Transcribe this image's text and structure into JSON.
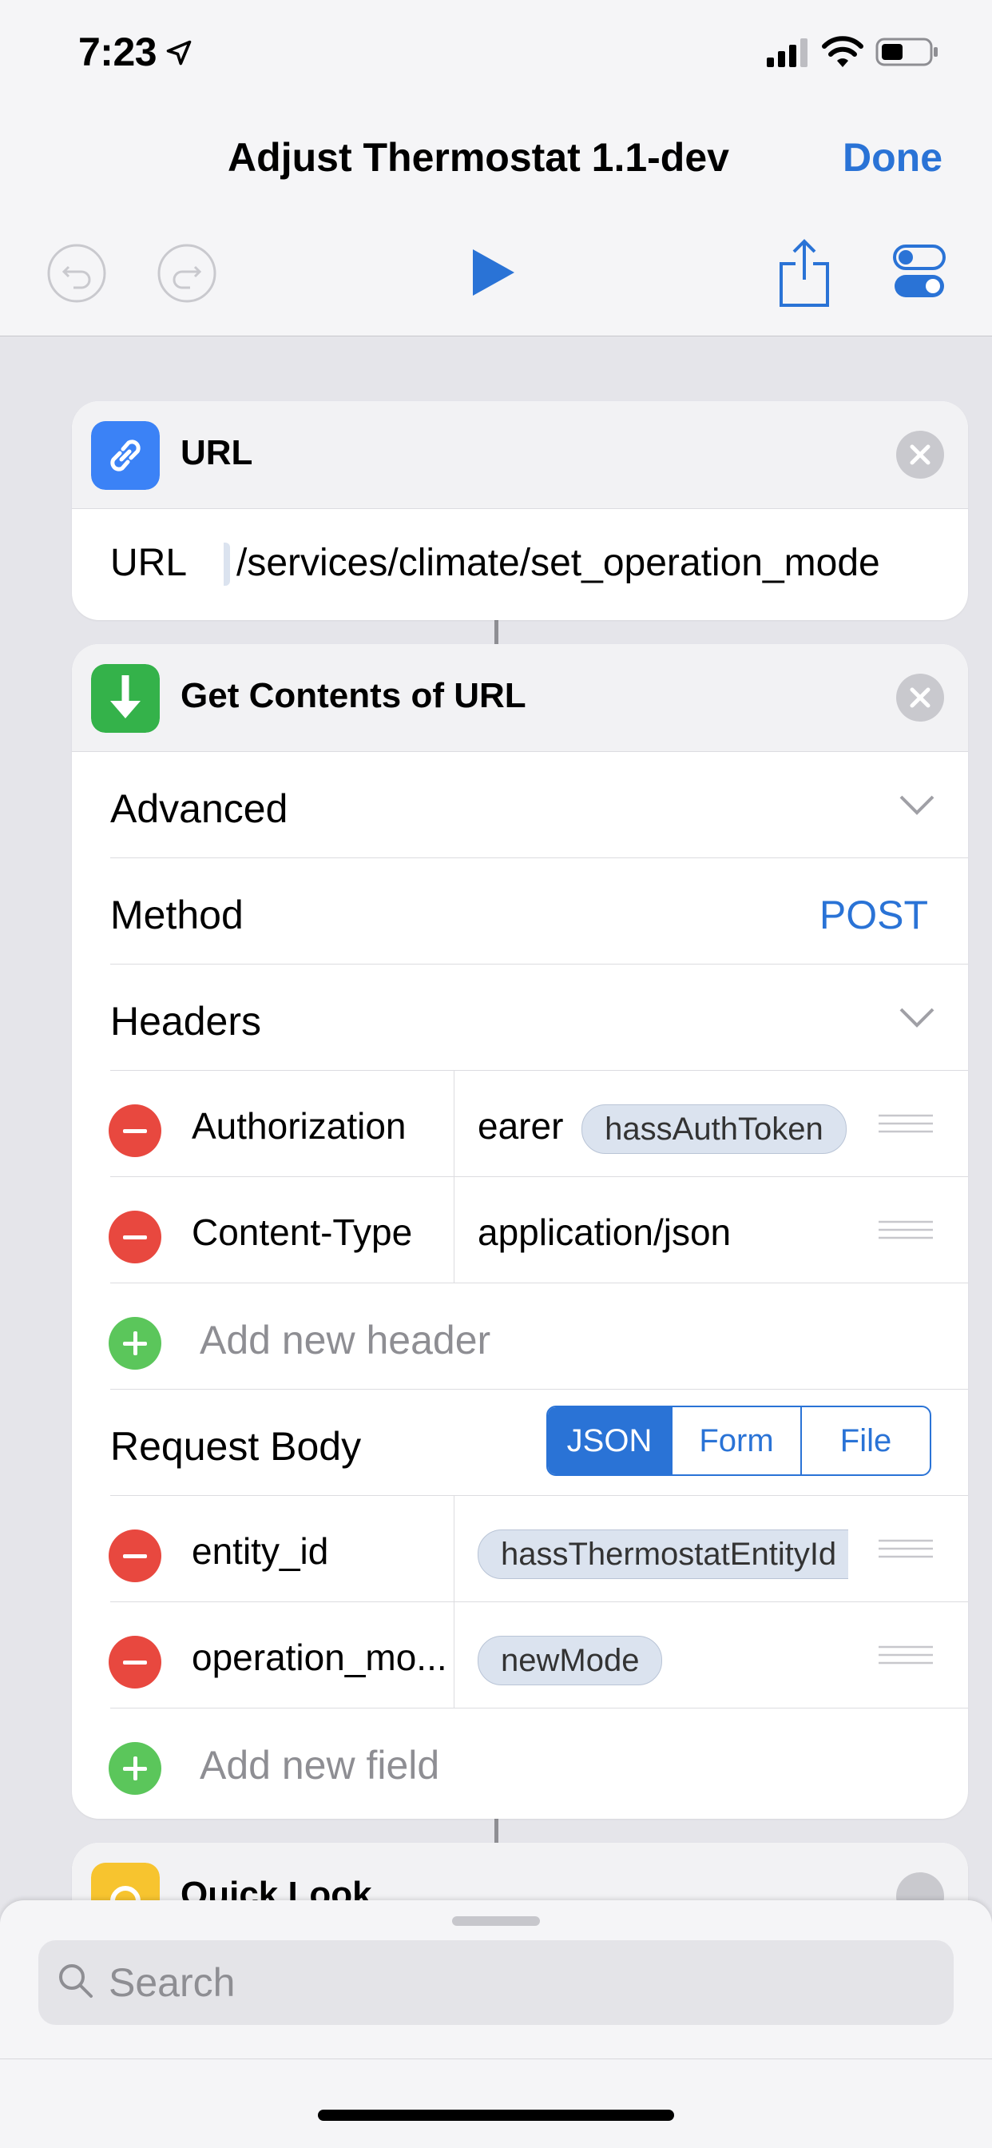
{
  "status_bar": {
    "time": "7:23"
  },
  "nav": {
    "title": "Adjust Thermostat 1.1-dev",
    "done_label": "Done"
  },
  "toolbar": {
    "icons": [
      "undo-icon",
      "redo-icon",
      "play-icon",
      "share-icon",
      "settings-toggle-icon"
    ]
  },
  "url_action": {
    "title": "URL",
    "field_label": "URL",
    "value": "/services/climate/set_operation_mode",
    "colors": {
      "icon_bg": "#3b82f6"
    }
  },
  "get_contents": {
    "title": "Get Contents of URL",
    "advanced_label": "Advanced",
    "method_label": "Method",
    "method_value": "POST",
    "headers_label": "Headers",
    "headers": [
      {
        "key": "Authorization",
        "value_prefix": "earer",
        "token": "hassAuthToken"
      },
      {
        "key": "Content-Type",
        "value": "application/json"
      }
    ],
    "add_header_placeholder": "Add new header",
    "request_body_label": "Request Body",
    "body_types": [
      "JSON",
      "Form",
      "File"
    ],
    "body_type_selected": "JSON",
    "fields": [
      {
        "key": "entity_id",
        "token": "hassThermostatEntityId"
      },
      {
        "key": "operation_mo...",
        "token": "newMode"
      }
    ],
    "add_field_placeholder": "Add new field",
    "colors": {
      "icon_bg": "#34b24a"
    }
  },
  "quick_look": {
    "title": "Quick Look",
    "colors": {
      "icon_bg": "#f7c42f"
    }
  },
  "search": {
    "placeholder": "Search"
  },
  "colors": {
    "accent": "#2a73d6",
    "delete": "#e8483f",
    "add": "#5bc65b"
  }
}
